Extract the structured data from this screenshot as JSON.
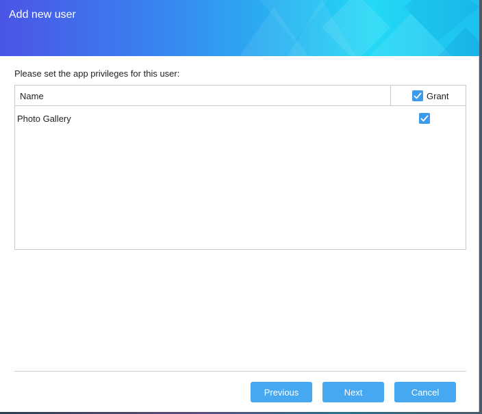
{
  "dialog": {
    "title": "Add new user",
    "instruction": "Please set the app privileges for this user:"
  },
  "table": {
    "columns": {
      "name": "Name",
      "grant": "Grant"
    },
    "grant_all_checked": true,
    "rows": [
      {
        "name": "Photo Gallery",
        "granted": true
      }
    ]
  },
  "buttons": {
    "previous": "Previous",
    "next": "Next",
    "cancel": "Cancel"
  },
  "colors": {
    "accent": "#46a8f0",
    "checkbox": "#3d9be9"
  },
  "icons": {
    "checkbox_checked": "checkmark-icon"
  }
}
